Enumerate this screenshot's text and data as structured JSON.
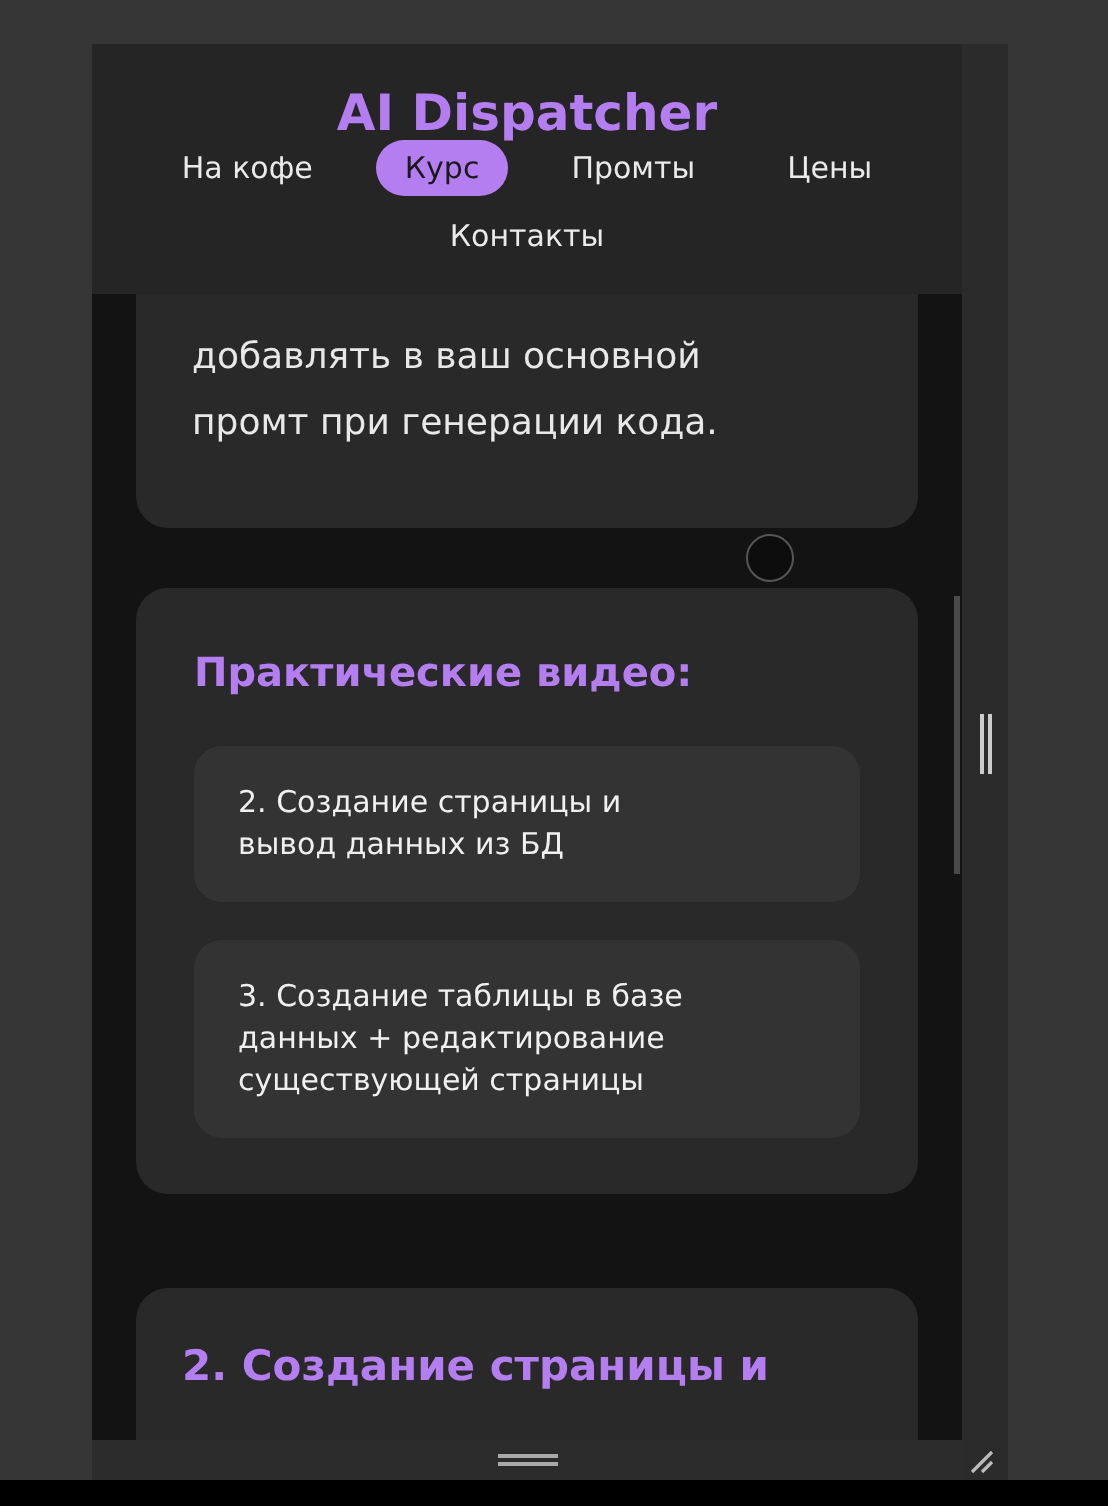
{
  "header": {
    "title": "AI Dispatcher",
    "nav": [
      {
        "label": "На кофе",
        "selected": false
      },
      {
        "label": "Курс",
        "selected": true
      },
      {
        "label": "Промты",
        "selected": false
      },
      {
        "label": "Цены",
        "selected": false
      },
      {
        "label": "Контакты",
        "selected": false
      }
    ]
  },
  "cards": [
    {
      "kind": "text",
      "text": "добавлять в ваш основной промт при генерации кода."
    },
    {
      "kind": "list",
      "title": "Практические видео:",
      "items": [
        "2. Создание страницы и вывод данных из БД",
        "3. Создание таблицы в базе данных + редактирование существующей страницы"
      ]
    },
    {
      "kind": "heading",
      "title": "2. Создание страницы и"
    }
  ]
}
